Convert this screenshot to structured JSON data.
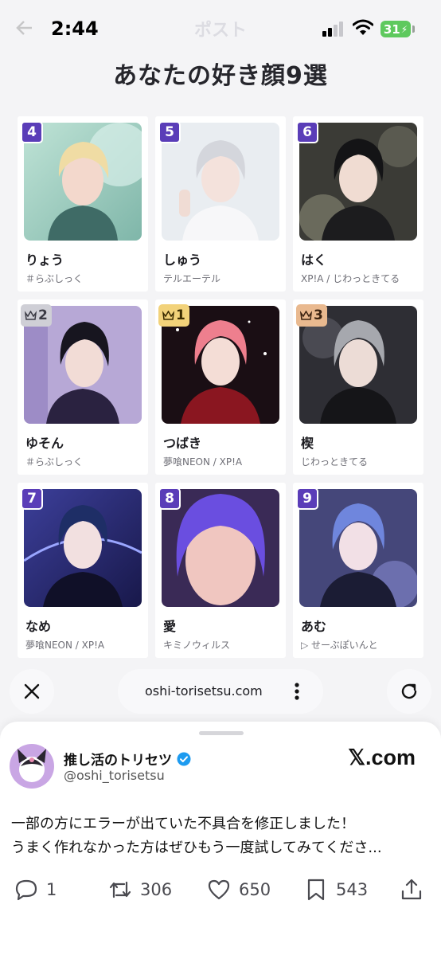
{
  "status_bar": {
    "time": "2:44",
    "battery": "31",
    "faded_title": "ポスト"
  },
  "page": {
    "title": "あなたの好き顔9選"
  },
  "cards": [
    {
      "rank": "4",
      "name": "りょう",
      "group": "＃らぶしっく"
    },
    {
      "rank": "5",
      "name": "しゅう",
      "group": "テルエーテル"
    },
    {
      "rank": "6",
      "name": "はく",
      "group": "XP!A / じわっときてる"
    },
    {
      "rank": "2",
      "name": "ゆそん",
      "group": "＃らぶしっく",
      "crown": "silver"
    },
    {
      "rank": "1",
      "name": "つばき",
      "group": "夢喰NEON / XP!A",
      "crown": "gold"
    },
    {
      "rank": "3",
      "name": "楔",
      "group": "じわっときてる",
      "crown": "bronze"
    },
    {
      "rank": "7",
      "name": "なめ",
      "group": "夢喰NEON / XP!A"
    },
    {
      "rank": "8",
      "name": "愛",
      "group": "キミノウィルス"
    },
    {
      "rank": "9",
      "name": "あむ",
      "group": "▷ せーぶぽいんと"
    }
  ],
  "browser": {
    "url": "oshi-torisetsu.com"
  },
  "post": {
    "account_name": "推し活のトリセツ",
    "handle": "@oshi_torisetsu",
    "site": "𝕏.com",
    "text_line1": "一部の方にエラーが出ていた不具合を修正しました！",
    "text_line2": "うまく作れなかった方はぜひもう一度試してみてくださ...",
    "replies": "1",
    "reposts": "306",
    "likes": "650",
    "bookmarks": "543"
  },
  "colors": {
    "rank_badge": "#5a3db8",
    "verified": "#1d9bf0",
    "battery": "#5ec95e"
  }
}
